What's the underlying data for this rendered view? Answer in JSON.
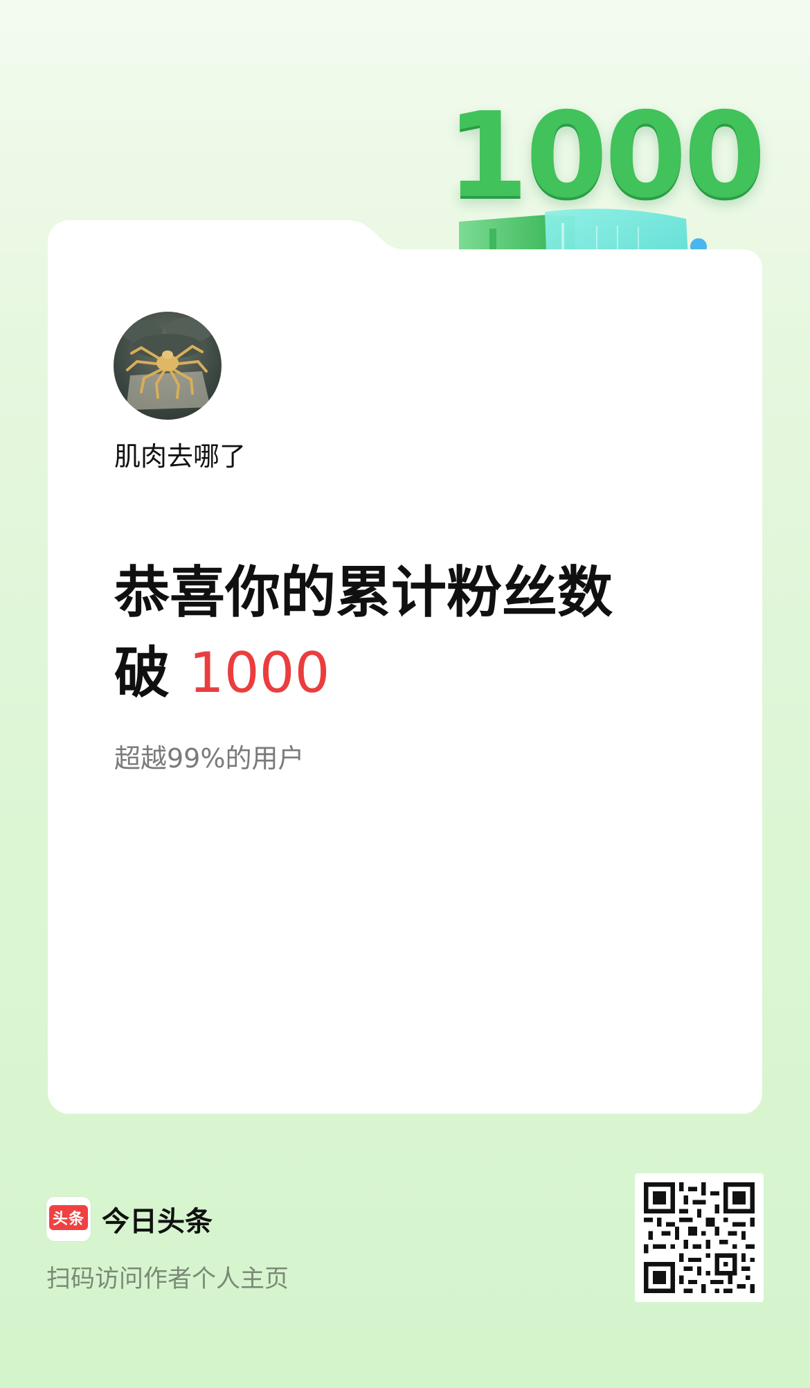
{
  "badge": {
    "number": "1000"
  },
  "profile": {
    "username": "肌肉去哪了",
    "avatar_icon": "spider-avatar-icon"
  },
  "headline": {
    "line1": "恭喜你的累计粉丝数",
    "line2_prefix": "破",
    "line2_number": "1000"
  },
  "subtext": "超越99%的用户",
  "footer": {
    "logo_text": "头条",
    "brand_name": "今日头条",
    "scan_text": "扫码访问作者个人主页"
  },
  "colors": {
    "accent_red": "#ea3e3e",
    "badge_green": "#41c25a",
    "brand_red": "#f04142"
  }
}
